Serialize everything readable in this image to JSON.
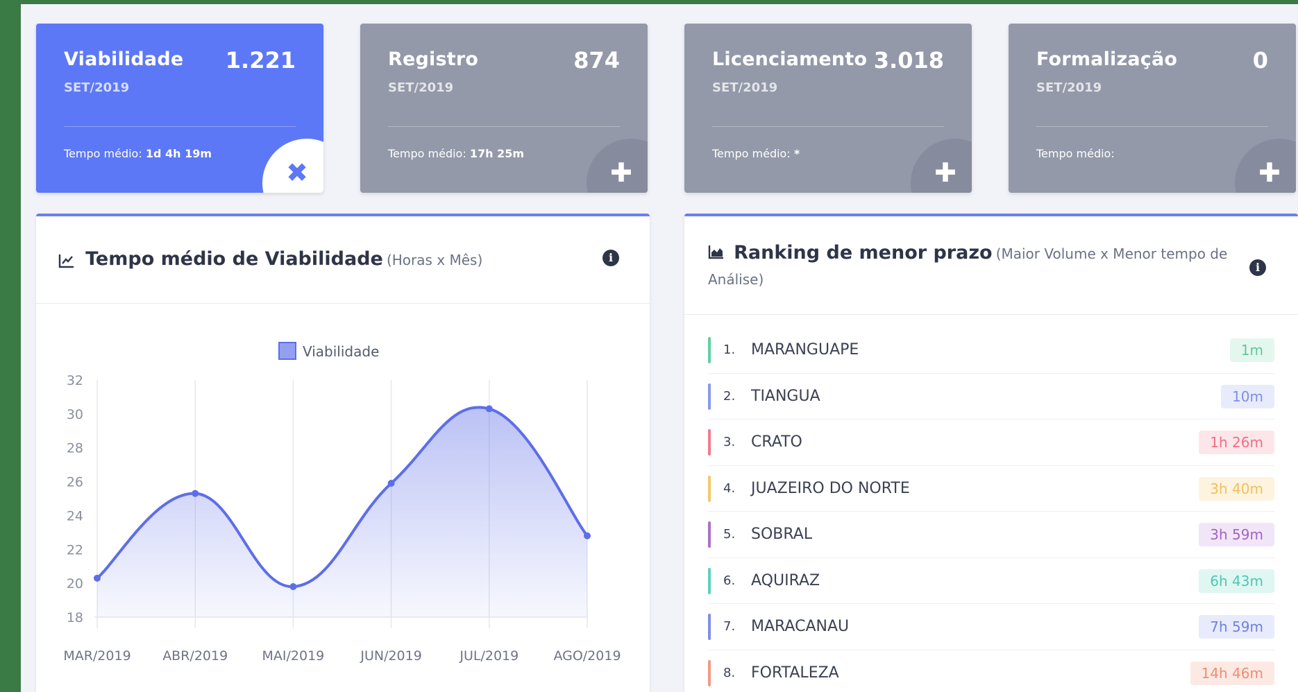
{
  "cards": [
    {
      "title": "Viabilidade",
      "count": "1.221",
      "period": "SET/2019",
      "avg_label": "Tempo médio:",
      "avg_value": "1d 4h 19m",
      "corner": "✖"
    },
    {
      "title": "Registro",
      "count": "874",
      "period": "SET/2019",
      "avg_label": "Tempo médio:",
      "avg_value": "17h 25m",
      "corner": "✚"
    },
    {
      "title": "Licenciamento",
      "count": "3.018",
      "period": "SET/2019",
      "avg_label": "Tempo médio:",
      "avg_value": "*",
      "corner": "✚"
    },
    {
      "title": "Formalização",
      "count": "0",
      "period": "SET/2019",
      "avg_label": "Tempo médio:",
      "avg_value": "",
      "corner": "✚"
    }
  ],
  "chart_widget": {
    "title": "Tempo médio de Viabilidade",
    "subtitle": "(Horas x Mês)",
    "title_icon": "line-chart-icon",
    "info_icon": "info-icon"
  },
  "ranking_widget": {
    "title": "Ranking de menor prazo",
    "subtitle_line1": "(Maior Volume x Menor tempo de",
    "subtitle_line2": "Análise)",
    "title_icon": "area-chart-icon",
    "info_icon": "info-icon",
    "items": [
      {
        "rank": "1.",
        "name": "MARANGUAPE",
        "time": "1m",
        "color": "#5fd0a2",
        "badge_bg": "#e4f7ee",
        "badge_fg": "#5fc79a"
      },
      {
        "rank": "2.",
        "name": "TIANGUA",
        "time": "10m",
        "color": "#8a98ec",
        "badge_bg": "#e8ebfb",
        "badge_fg": "#7f8ee6"
      },
      {
        "rank": "3.",
        "name": "CRATO",
        "time": "1h 26m",
        "color": "#f07b8e",
        "badge_bg": "#fde6ea",
        "badge_fg": "#ee6f84"
      },
      {
        "rank": "4.",
        "name": "JUAZEIRO DO NORTE",
        "time": "3h 40m",
        "color": "#f6c86a",
        "badge_bg": "#fdf3df",
        "badge_fg": "#f2bf58"
      },
      {
        "rank": "5.",
        "name": "SOBRAL",
        "time": "3h 59m",
        "color": "#a873c8",
        "badge_bg": "#f1e6f7",
        "badge_fg": "#a064c2"
      },
      {
        "rank": "6.",
        "name": "AQUIRAZ",
        "time": "6h 43m",
        "color": "#5fd0c0",
        "badge_bg": "#e0f6f2",
        "badge_fg": "#4ec7b4"
      },
      {
        "rank": "7.",
        "name": "MARACANAU",
        "time": "7h 59m",
        "color": "#7f8ee6",
        "badge_bg": "#e8ebfb",
        "badge_fg": "#6f80e0"
      },
      {
        "rank": "8.",
        "name": "FORTALEZA",
        "time": "14h 46m",
        "color": "#f49a82",
        "badge_bg": "#fde9e3",
        "badge_fg": "#f08c72"
      }
    ]
  },
  "chart_data": {
    "type": "area",
    "categories": [
      "MAR/2019",
      "ABR/2019",
      "MAI/2019",
      "JUN/2019",
      "JUL/2019",
      "AGO/2019"
    ],
    "series": [
      {
        "name": "Viabilidade",
        "values": [
          20.3,
          25.3,
          19.8,
          25.9,
          30.3,
          22.8
        ]
      }
    ],
    "ylim": [
      18,
      32
    ],
    "yticks": [
      18,
      20,
      22,
      24,
      26,
      28,
      30,
      32
    ],
    "color": "#5d6ee8",
    "legend": "top-center",
    "grid": "vertical"
  }
}
